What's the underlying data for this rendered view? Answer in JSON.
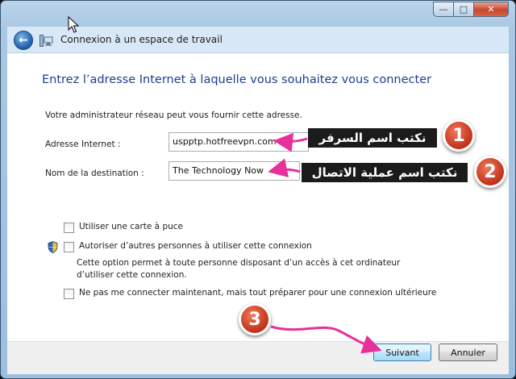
{
  "window": {
    "title": "Connexion à un espace de travail",
    "minimize_glyph": "—",
    "maximize_glyph": "□",
    "close_glyph": "✕"
  },
  "header": {
    "back_icon": "back-arrow-icon",
    "app_icon": "network-connection-icon"
  },
  "main": {
    "heading": "Entrez l’adresse Internet à laquelle vous souhaitez vous connecter",
    "hint": "Votre administrateur réseau peut vous fournir cette adresse.",
    "fields": {
      "address_label": "Adresse Internet :",
      "address_value": "uspptp.hotfreevpn.com",
      "destination_label": "Nom de la destination :",
      "destination_value": "The Technology Now"
    },
    "options": {
      "smartcard_label": "Utiliser une carte à puce",
      "smartcard_checked": false,
      "share_label": "Autoriser d’autres personnes à utiliser cette connexion",
      "share_checked": false,
      "share_desc": "Cette option permet à toute personne disposant d’un accès à cet ordinateur d’utiliser cette connexion.",
      "later_label": "Ne pas me connecter maintenant, mais tout préparer pour une connexion ultérieure",
      "later_checked": false
    }
  },
  "footer": {
    "next_label": "Suivant",
    "cancel_label": "Annuler"
  },
  "annotations": {
    "callout_1_number": "1",
    "callout_1_text": "نكتب اسم السرفر",
    "callout_2_number": "2",
    "callout_2_text": "نكتب اسم عملية الاتصال",
    "callout_3_number": "3",
    "arrow_color": "#e8309a",
    "badge_color": "#d13b22"
  }
}
